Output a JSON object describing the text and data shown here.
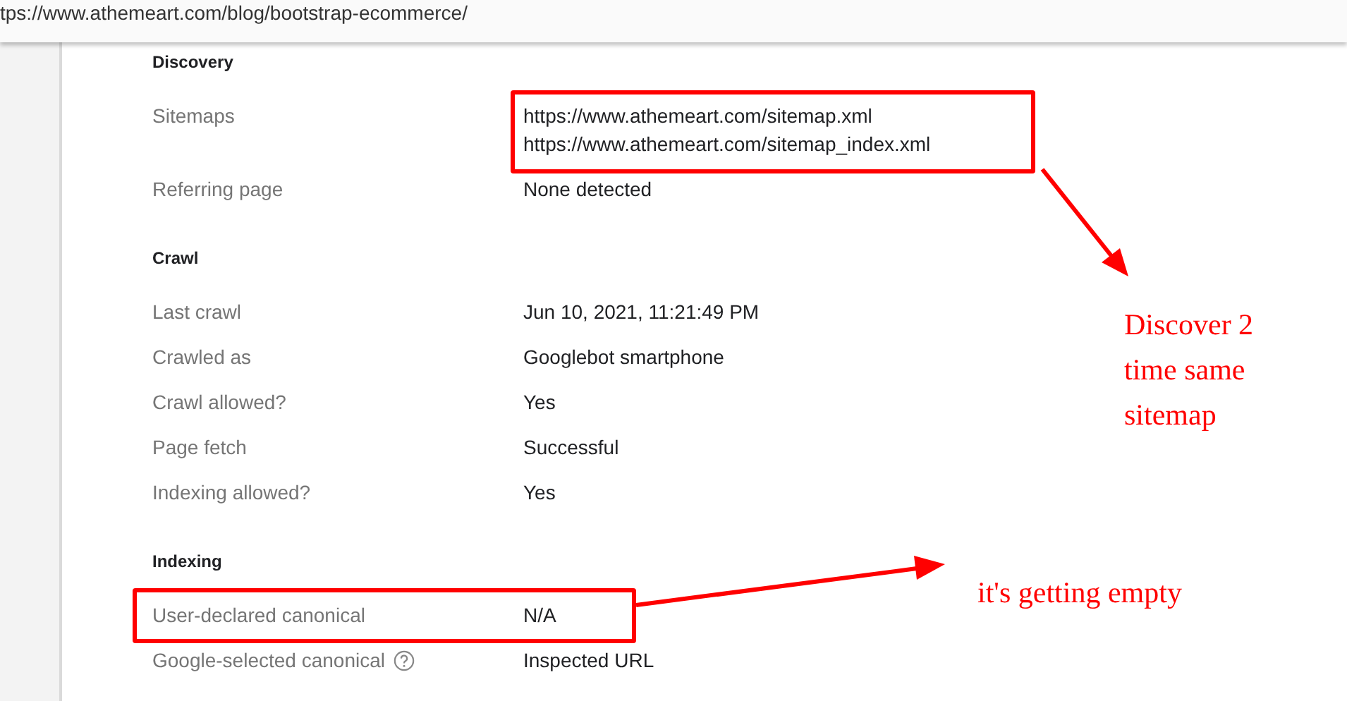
{
  "address_bar": {
    "url": "tps://www.athemeart.com/blog/bootstrap-ecommerce/"
  },
  "sections": [
    {
      "title": "Discovery",
      "rows": [
        {
          "label": "Sitemaps",
          "values": [
            "https://www.athemeart.com/sitemap.xml",
            "https://www.athemeart.com/sitemap_index.xml"
          ],
          "help": false
        },
        {
          "label": "Referring page",
          "values": [
            "None detected"
          ],
          "help": false
        }
      ]
    },
    {
      "title": "Crawl",
      "rows": [
        {
          "label": "Last crawl",
          "values": [
            "Jun 10, 2021, 11:21:49 PM"
          ],
          "help": false
        },
        {
          "label": "Crawled as",
          "values": [
            "Googlebot smartphone"
          ],
          "help": false
        },
        {
          "label": "Crawl allowed?",
          "values": [
            "Yes"
          ],
          "help": false
        },
        {
          "label": "Page fetch",
          "values": [
            "Successful"
          ],
          "help": false
        },
        {
          "label": "Indexing allowed?",
          "values": [
            "Yes"
          ],
          "help": false
        }
      ]
    },
    {
      "title": "Indexing",
      "rows": [
        {
          "label": "User-declared canonical",
          "values": [
            "N/A"
          ],
          "help": false
        },
        {
          "label": "Google-selected canonical",
          "values": [
            "Inspected URL"
          ],
          "help": true
        }
      ]
    }
  ],
  "annotations": [
    {
      "text": "Discover 2 time same sitemap"
    },
    {
      "text": "it's getting empty"
    }
  ]
}
